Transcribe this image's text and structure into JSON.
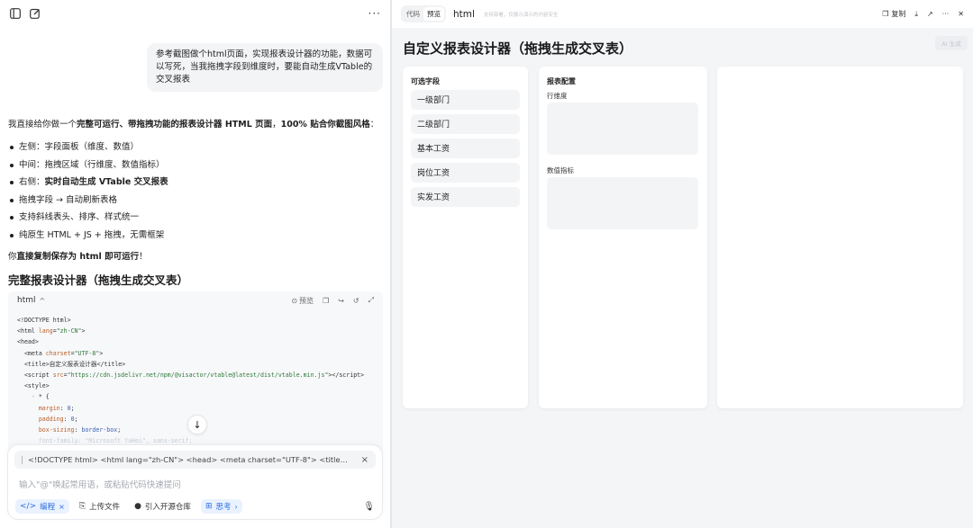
{
  "left": {
    "user_message": "参考截图做个html页面，实现报表设计器的功能，数据可以写死，当我拖拽字段到维度时，要能自动生成VTable的交叉报表",
    "intro_pre": "我直接给你做一个",
    "intro_bold": "完整可运行、带拖拽功能的报表设计器 HTML 页面",
    "intro_mid": "，",
    "intro_bold2": "100% 贴合你截图风格",
    "intro_post": "：",
    "bullets": [
      {
        "text": "左侧：字段面板（维度、数值）",
        "bold": ""
      },
      {
        "text": "中间：拖拽区域（行维度、数值指标）",
        "bold": ""
      },
      {
        "text": "右侧：",
        "bold": "实时自动生成 VTable 交叉报表"
      },
      {
        "text": "拖拽字段 → 自动刷新表格",
        "bold": ""
      },
      {
        "text": "支持斜线表头、排序、样式统一",
        "bold": ""
      },
      {
        "text": "纯原生 HTML + JS + 拖拽，无需框架",
        "bold": ""
      }
    ],
    "save_pre": "你",
    "save_bold": "直接复制保存为 html 即可运行",
    "save_post": "！",
    "section_title": "完整报表设计器（拖拽生成交叉表）",
    "code_block": {
      "lang": "html",
      "preview_label": "预览"
    },
    "composer": {
      "quote": "<!DOCTYPE html> <html lang=\"zh-CN\"> <head> <meta charset=\"UTF-8\"> <title>自定义报...",
      "placeholder": "输入\"@\"唤起常用语，或粘贴代码快速提问",
      "chip_code": "编程",
      "chip_upload": "上传文件",
      "chip_repo": "引入开源仓库",
      "chip_think": "思考"
    }
  },
  "right": {
    "seg_code": "代码",
    "seg_preview": "预览",
    "title": "html",
    "subtitle": "支持部署，仅展示演示的内容安全",
    "copy_label": "复制",
    "ai_badge": "AI 生成",
    "page_title": "自定义报表设计器（拖拽生成交叉表）",
    "fields_title": "可选字段",
    "fields": [
      "一级部门",
      "二级部门",
      "基本工资",
      "岗位工资",
      "实发工资"
    ],
    "config_title": "报表配置",
    "row_dim_label": "行维度",
    "measure_label": "数值指标"
  }
}
